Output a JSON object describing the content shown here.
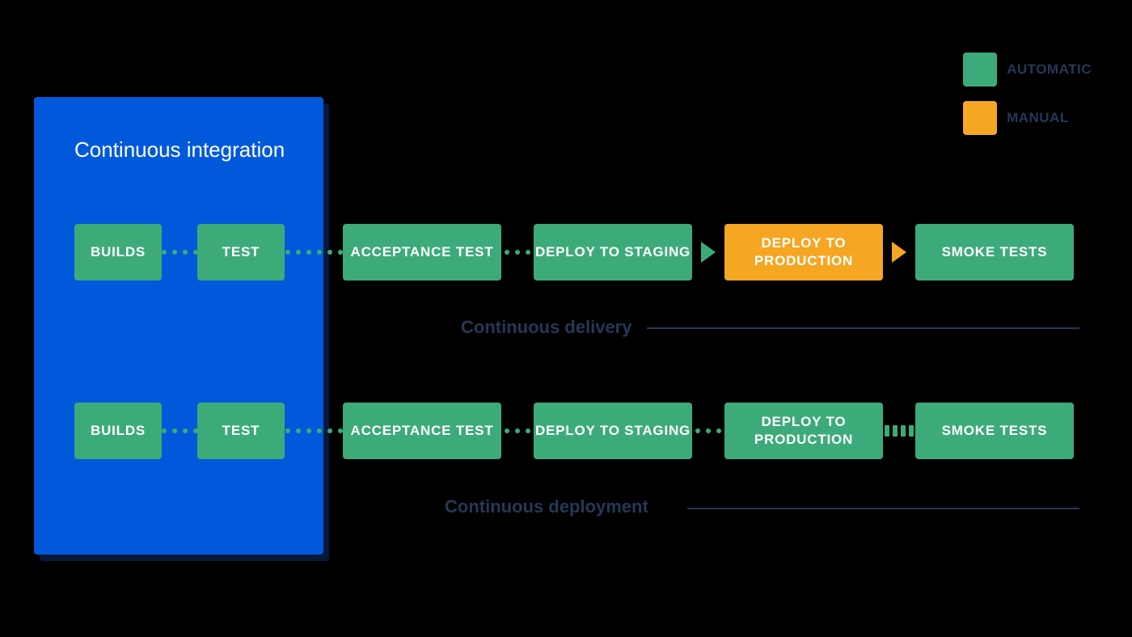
{
  "legend": {
    "automatic": "AUTOMATIC",
    "manual": "MANUAL"
  },
  "ci_title": "Continuous integration",
  "stages": {
    "builds": "BUILDS",
    "test": "TEST",
    "acceptance": "ACCEPTANCE TEST",
    "staging": "DEPLOY TO STAGING",
    "production": "DEPLOY TO PRODUCTION",
    "smoke": "SMOKE TESTS"
  },
  "labels": {
    "delivery": "Continuous delivery",
    "deployment": "Continuous deployment"
  }
}
